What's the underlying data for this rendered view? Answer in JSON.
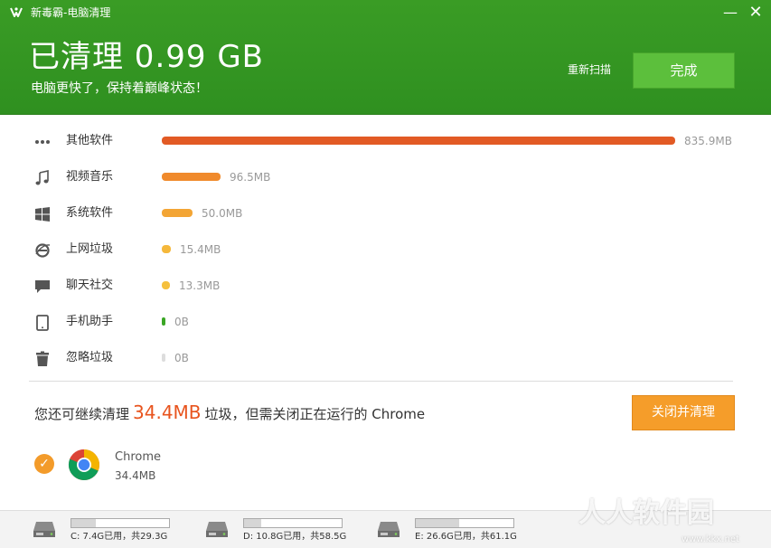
{
  "window": {
    "title": "新毒霸-电脑清理",
    "minimize_glyph": "—",
    "close_glyph": "✕"
  },
  "header": {
    "headline": "已清理 0.99 GB",
    "subline": "电脑更快了，保持着巅峰状态！",
    "rescan_label": "重新扫描",
    "done_label": "完成"
  },
  "categories": [
    {
      "label": "其他软件",
      "icon": "more-dots-icon",
      "value": "835.9MB",
      "fraction": 1.0,
      "color": "#e25a24"
    },
    {
      "label": "视频音乐",
      "icon": "music-note-icon",
      "value": "96.5MB",
      "fraction": 0.115,
      "color": "#f08a2c"
    },
    {
      "label": "系统软件",
      "icon": "windows-icon",
      "value": "50.0MB",
      "fraction": 0.06,
      "color": "#f3a535"
    },
    {
      "label": "上网垃圾",
      "icon": "ie-browser-icon",
      "value": "15.4MB",
      "fraction": 0.018,
      "color": "#f5b83b"
    },
    {
      "label": "聊天社交",
      "icon": "chat-bubble-icon",
      "value": "13.3MB",
      "fraction": 0.016,
      "color": "#f5c03d"
    },
    {
      "label": "手机助手",
      "icon": "phone-icon",
      "value": "0B",
      "fraction": 0.0,
      "color": "#3aa625"
    },
    {
      "label": "忽略垃圾",
      "icon": "trash-icon",
      "value": "0B",
      "fraction": 0.0,
      "color": "#dddddd"
    }
  ],
  "notice": {
    "prefix": "您还可继续清理",
    "amount": "34.4MB",
    "suffix": "垃圾，但需关闭正在运行的 Chrome",
    "button_label": "关闭并清理"
  },
  "running_app": {
    "name": "Chrome",
    "size": "34.4MB",
    "icon": "chrome-icon",
    "check_glyph": "✓"
  },
  "drives": [
    {
      "label": "C: 7.4G已用，共29.3G",
      "used_fraction": 0.25
    },
    {
      "label": "D: 10.8G已用，共58.5G",
      "used_fraction": 0.18
    },
    {
      "label": "E: 26.6G已用，共61.1G",
      "used_fraction": 0.44
    }
  ],
  "watermark": {
    "text": "人人软件园",
    "url": "www.kkx.net"
  },
  "colors": {
    "header_green": "#329421",
    "accent_orange": "#f59d2a",
    "highlight_red": "#e8541e"
  }
}
